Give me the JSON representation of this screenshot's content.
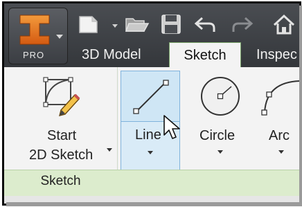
{
  "app_button": {
    "logo": "inventor-logo",
    "edition": "PRO"
  },
  "quick_access": [
    {
      "icon": "new-document-icon"
    },
    {
      "icon": "open-folder-icon"
    },
    {
      "icon": "save-icon"
    },
    {
      "icon": "undo-icon"
    },
    {
      "icon": "redo-icon"
    },
    {
      "icon": "home-icon"
    }
  ],
  "tabs": [
    {
      "label": "3D Model",
      "active": false
    },
    {
      "label": "Sketch",
      "active": true
    },
    {
      "label": "Inspec",
      "active": false
    }
  ],
  "ribbon": {
    "start_sketch": {
      "line1": "Start",
      "line2": "2D Sketch",
      "icon": "start-2d-sketch-icon"
    },
    "line": {
      "label": "Line",
      "icon": "line-icon"
    },
    "circle": {
      "label": "Circle",
      "icon": "circle-icon"
    },
    "arc": {
      "label": "Arc",
      "icon": "arc-icon"
    },
    "panel_title": "Sketch"
  },
  "colors": {
    "accent_green": "#dceccd",
    "highlight_blue": "#cfe6f5",
    "logo_orange": "#e8731f"
  }
}
